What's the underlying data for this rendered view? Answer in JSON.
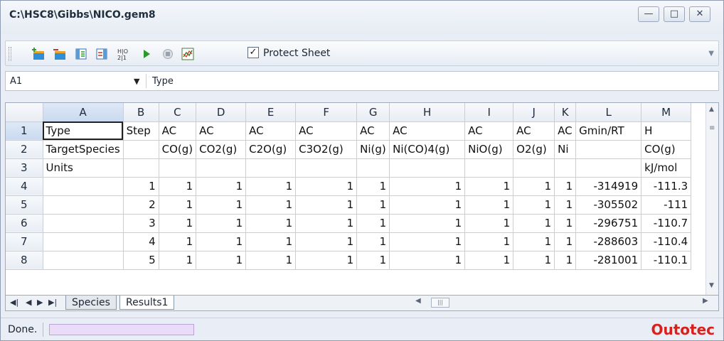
{
  "window": {
    "title": "C:\\HSC8\\Gibbs\\NICO.gem8",
    "minimize_icon": "minimize-icon",
    "maximize_icon": "maximize-icon",
    "close_icon": "close-icon"
  },
  "toolbar": {
    "icons": [
      "add-sheet-icon",
      "remove-sheet-icon",
      "insert-column-icon",
      "delete-column-icon",
      "sort-icon",
      "run-icon",
      "stop-icon",
      "chart-icon"
    ],
    "protect_label": "Protect Sheet",
    "protect_checked": true
  },
  "formula_bar": {
    "cell_ref": "A1",
    "value": "Type"
  },
  "grid": {
    "columns": [
      "A",
      "B",
      "C",
      "D",
      "E",
      "F",
      "G",
      "H",
      "I",
      "J",
      "K",
      "L",
      "M"
    ],
    "row_numbers": [
      "1",
      "2",
      "3",
      "4",
      "5",
      "6",
      "7",
      "8"
    ],
    "rows": [
      [
        "Type",
        "Step",
        "AC",
        "AC",
        "AC",
        "AC",
        "AC",
        "AC",
        "AC",
        "AC",
        "AC",
        "Gmin/RT",
        "H"
      ],
      [
        "TargetSpecies",
        "",
        "CO(g)",
        "CO2(g)",
        "C2O(g)",
        "C3O2(g)",
        "Ni(g)",
        "Ni(CO)4(g)",
        "NiO(g)",
        "O2(g)",
        "Ni",
        "",
        "CO(g)"
      ],
      [
        "Units",
        "",
        "",
        "",
        "",
        "",
        "",
        "",
        "",
        "",
        "",
        "",
        "kJ/mol"
      ],
      [
        "",
        "1",
        "1",
        "1",
        "1",
        "1",
        "1",
        "1",
        "1",
        "1",
        "1",
        "-314919",
        "-111.3"
      ],
      [
        "",
        "2",
        "1",
        "1",
        "1",
        "1",
        "1",
        "1",
        "1",
        "1",
        "1",
        "-305502",
        "-111"
      ],
      [
        "",
        "3",
        "1",
        "1",
        "1",
        "1",
        "1",
        "1",
        "1",
        "1",
        "1",
        "-296751",
        "-110.7"
      ],
      [
        "",
        "4",
        "1",
        "1",
        "1",
        "1",
        "1",
        "1",
        "1",
        "1",
        "1",
        "-288603",
        "-110.4"
      ],
      [
        "",
        "5",
        "1",
        "1",
        "1",
        "1",
        "1",
        "1",
        "1",
        "1",
        "1",
        "-281001",
        "-110.1"
      ]
    ]
  },
  "sheets": {
    "tabs": [
      "Species",
      "Results1"
    ],
    "active": "Results1"
  },
  "status": {
    "text": "Done.",
    "progress": 0,
    "brand": "Outotec"
  }
}
